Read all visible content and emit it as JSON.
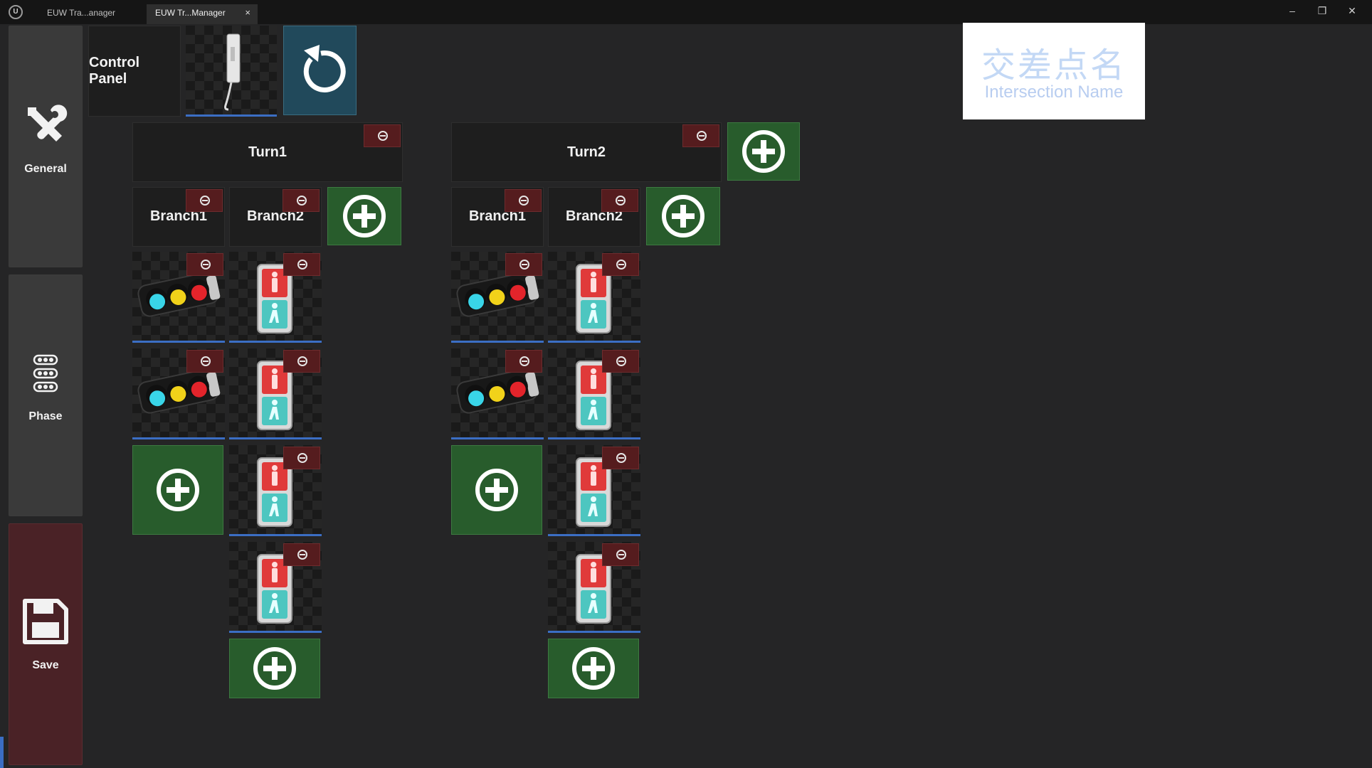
{
  "window": {
    "tabs": [
      {
        "label": "EUW Tra...anager"
      },
      {
        "label": "EUW Tr...Manager",
        "close": "×"
      }
    ],
    "controls": {
      "minimize": "–",
      "restore": "❐",
      "close": "✕"
    }
  },
  "sidebar": {
    "general": {
      "label": "General",
      "icon": "tools-icon"
    },
    "phase": {
      "label": "Phase",
      "icon": "traffic-lights-icon"
    },
    "save": {
      "label": "Save",
      "icon": "floppy-disk-icon"
    }
  },
  "toolbar": {
    "control_panel_label": "Control Panel",
    "controller_icon": "controller-cabinet-icon",
    "refresh_icon": "refresh-icon"
  },
  "intersection_name": {
    "chinese": "交差点名",
    "english": "Intersection Name"
  },
  "turns": [
    {
      "label": "Turn1",
      "branches": [
        {
          "label": "Branch1",
          "devices": [
            "vehicle-signal",
            "vehicle-signal"
          ]
        },
        {
          "label": "Branch2",
          "devices": [
            "pedestrian-signal",
            "pedestrian-signal",
            "pedestrian-signal",
            "pedestrian-signal"
          ]
        }
      ]
    },
    {
      "label": "Turn2",
      "branches": [
        {
          "label": "Branch1",
          "devices": [
            "vehicle-signal",
            "vehicle-signal"
          ]
        },
        {
          "label": "Branch2",
          "devices": [
            "pedestrian-signal",
            "pedestrian-signal",
            "pedestrian-signal",
            "pedestrian-signal"
          ]
        }
      ]
    }
  ],
  "colors": {
    "background": "#252526",
    "remove_button": "#551c1e",
    "add_button": "#285c2c",
    "accent_underline": "#3b6ec4",
    "refresh_button": "#21495b",
    "save_panel": "#4a2226"
  }
}
